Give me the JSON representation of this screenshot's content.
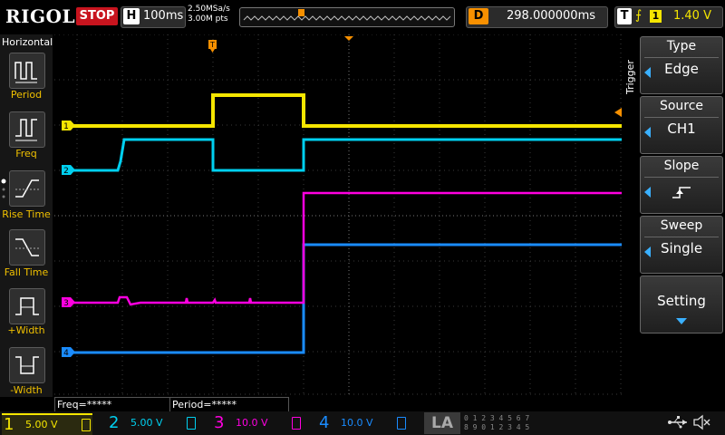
{
  "header": {
    "brand": "RIGOL",
    "run_state": "STOP",
    "timebase_key": "H",
    "timebase": "100ms",
    "sample_rate": "2.50MSa/s",
    "mem_depth": "3.00M pts",
    "delay_key": "D",
    "delay": "298.000000ms",
    "trigger_key": "T",
    "trigger_source_num": "1",
    "trigger_level": "1.40 V",
    "trigger_marker": "T"
  },
  "left_panel": {
    "title": "Horizontal",
    "items": [
      {
        "label": "Period",
        "icon": "period-icon"
      },
      {
        "label": "Freq",
        "icon": "freq-icon"
      },
      {
        "label": "Rise Time",
        "icon": "rise-time-icon"
      },
      {
        "label": "Fall Time",
        "icon": "fall-time-icon"
      },
      {
        "label": "+Width",
        "icon": "positive-width-icon"
      },
      {
        "label": "-Width",
        "icon": "negative-width-icon"
      }
    ]
  },
  "right_panel": {
    "section_label": "Trigger",
    "type": {
      "title": "Type",
      "value": "Edge"
    },
    "source": {
      "title": "Source",
      "value": "CH1"
    },
    "slope": {
      "title": "Slope",
      "icon": "rising-edge-icon"
    },
    "sweep": {
      "title": "Sweep",
      "value": "Single"
    },
    "setting": {
      "title": "Setting",
      "icon": "chevron-down-icon"
    }
  },
  "measurements": {
    "freq": "Freq=*****",
    "period": "Period=*****"
  },
  "channels": [
    {
      "num": "1",
      "scale": "5.00 V",
      "color": "#f5e600"
    },
    {
      "num": "2",
      "scale": "5.00 V",
      "color": "#00d0f0"
    },
    {
      "num": "3",
      "scale": "10.0 V",
      "color": "#ff00e0"
    },
    {
      "num": "4",
      "scale": "10.0 V",
      "color": "#1a8cff"
    }
  ],
  "bottom": {
    "la_label": "LA",
    "digital_row1": "0 1 2 3  4 5 6 7",
    "digital_row2": "8 9 0 1  2 3 4 5"
  },
  "waveform_markers": [
    "1",
    "2",
    "3",
    "4"
  ],
  "icons": [
    "usb-icon",
    "speaker-mute-icon"
  ]
}
